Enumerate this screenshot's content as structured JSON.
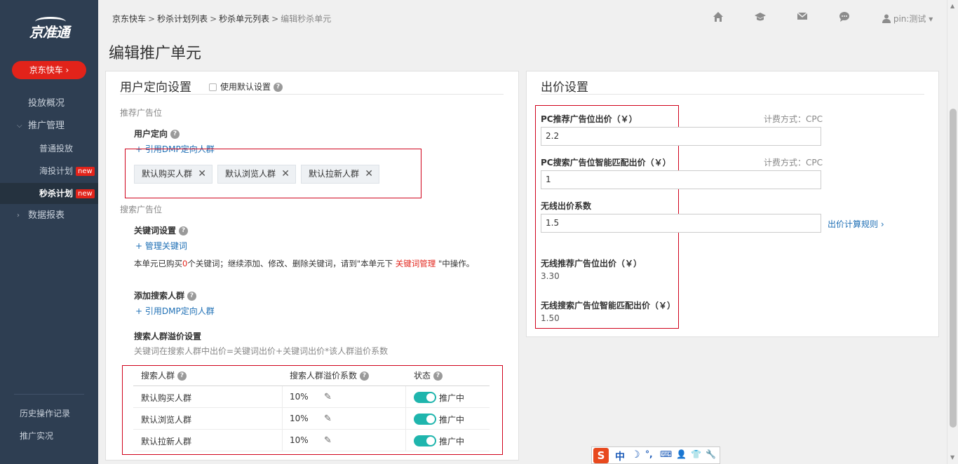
{
  "sidebar": {
    "logo": "京准通",
    "cta": "京东快车 ›",
    "items": [
      {
        "label": "投放概况"
      },
      {
        "label": "推广管理",
        "caret": "⌵"
      },
      {
        "label": "普通投放"
      },
      {
        "label": "海投计划",
        "badge": "new"
      },
      {
        "label": "秒杀计划",
        "badge": "new"
      },
      {
        "label": "数据报表",
        "caret": "›"
      }
    ],
    "bottom": [
      "历史操作记录",
      "推广实况"
    ]
  },
  "breadcrumb": {
    "items": [
      "京东快车",
      "秒杀计划列表",
      "秒杀单元列表"
    ],
    "current": "编辑秒杀单元",
    "sep": ">"
  },
  "topbar": {
    "icons": [
      "home-icon",
      "graduation-cap-icon",
      "mail-icon",
      "chat-icon",
      "user-icon"
    ],
    "user": "pin:测试"
  },
  "page_title": "编辑推广单元",
  "targeting": {
    "title": "用户定向设置",
    "use_default_label": "使用默认设置",
    "recommend_section": "推荐广告位",
    "user_targeting_label": "用户定向",
    "dmp_link": "+ 引用DMP定向人群",
    "tags": [
      "默认购买人群",
      "默认浏览人群",
      "默认拉新人群"
    ],
    "search_section": "搜索广告位",
    "keyword_label": "关键词设置",
    "manage_link": "+ 管理关键词",
    "kw_text_1": "本单元已购买",
    "kw_count": "0",
    "kw_text_2": "个关键词；继续添加、修改、删除关键词，请到\"本单元下",
    "kw_link": "关键词管理",
    "kw_text_3": "\"中操作。",
    "add_crowd_label": "添加搜索人群",
    "dmp_link2": "+ 引用DMP定向人群",
    "premium_label": "搜索人群溢价设置",
    "premium_desc": "关键词在搜索人群中出价=关键词出价+关键词出价*该人群溢价系数",
    "table_headers": [
      "搜索人群",
      "搜索人群溢价系数",
      "状态"
    ],
    "rows": [
      {
        "crowd": "默认购买人群",
        "premium": "10%",
        "status": "推广中"
      },
      {
        "crowd": "默认浏览人群",
        "premium": "10%",
        "status": "推广中"
      },
      {
        "crowd": "默认拉新人群",
        "premium": "10%",
        "status": "推广中"
      }
    ]
  },
  "bidding": {
    "title": "出价设置",
    "pc_rec_label": "PC推荐广告位出价（￥）",
    "pc_rec_billing": "计费方式：CPC",
    "pc_rec_value": "2.2",
    "pc_search_label": "PC搜索广告位智能匹配出价（￥）",
    "pc_search_billing": "计费方式：CPC",
    "pc_search_value": "1",
    "wireless_coef_label": "无线出价系数",
    "wireless_coef_value": "1.5",
    "rule_link": "出价计算规则 ›",
    "wireless_rec_label": "无线推荐广告位出价（￥）",
    "wireless_rec_value": "3.30",
    "wireless_search_label": "无线搜索广告位智能匹配出价（￥）",
    "wireless_search_value": "1.50"
  },
  "ime": {
    "brand": "S",
    "glyphs": [
      "中",
      "☽",
      "°,",
      "⌨",
      "👤",
      "👕",
      "🔧"
    ]
  }
}
